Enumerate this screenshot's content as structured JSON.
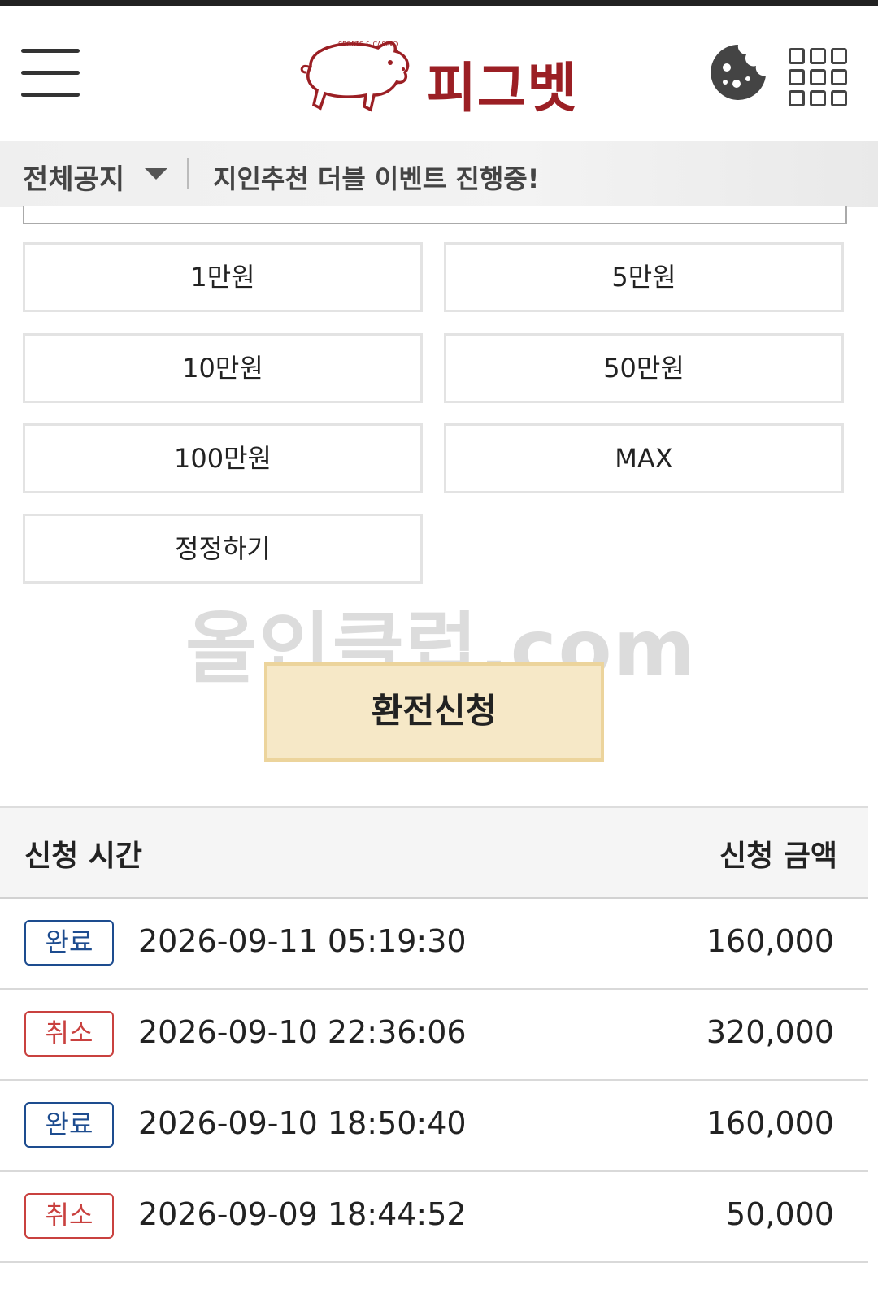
{
  "header": {
    "brand_name": "피그벳",
    "brand_tagline": "SPORTS & CASINO",
    "menu_icon": "hamburger-menu-icon",
    "cookie_icon": "cookie-icon",
    "apps_icon": "apps-grid-icon",
    "brand_color": "#9b1f24"
  },
  "notice": {
    "label": "전체공지",
    "text": "지인추천 더블 이벤트 진행중!"
  },
  "amount_buttons": [
    {
      "label": "1만원"
    },
    {
      "label": "5만원"
    },
    {
      "label": "10만원"
    },
    {
      "label": "50만원"
    },
    {
      "label": "100만원"
    },
    {
      "label": "MAX"
    },
    {
      "label": "정정하기"
    }
  ],
  "watermark": "올인클럽.com",
  "submit_label": "환전신청",
  "history": {
    "col_time": "신청 시간",
    "col_amount": "신청 금액",
    "rows": [
      {
        "status": "완료",
        "time": "2026-09-11 05:19:30",
        "amount": "160,000"
      },
      {
        "status": "취소",
        "time": "2026-09-10 22:36:06",
        "amount": "320,000"
      },
      {
        "status": "완료",
        "time": "2026-09-10 18:50:40",
        "amount": "160,000"
      },
      {
        "status": "취소",
        "time": "2026-09-09 18:44:52",
        "amount": "50,000"
      }
    ]
  },
  "colors": {
    "done": "#1d4c8f",
    "cancel": "#c9413f",
    "submit_bg": "#f6e8c7"
  }
}
